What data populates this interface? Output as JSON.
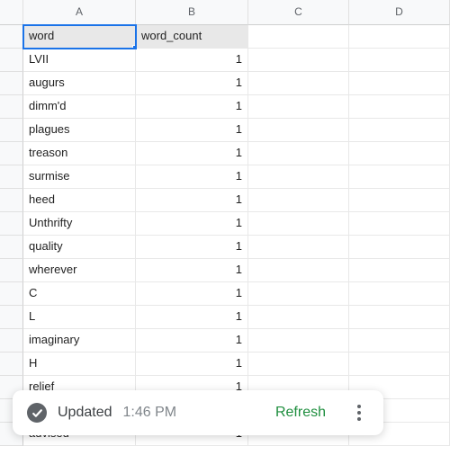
{
  "columns": [
    "A",
    "B",
    "C",
    "D"
  ],
  "header_row": {
    "col_a": "word",
    "col_b": "word_count"
  },
  "active_cell": "A1",
  "rows": [
    {
      "word": "LVII",
      "count": "1"
    },
    {
      "word": "augurs",
      "count": "1"
    },
    {
      "word": "dimm'd",
      "count": "1"
    },
    {
      "word": "plagues",
      "count": "1"
    },
    {
      "word": "treason",
      "count": "1"
    },
    {
      "word": "surmise",
      "count": "1"
    },
    {
      "word": "heed",
      "count": "1"
    },
    {
      "word": "Unthrifty",
      "count": "1"
    },
    {
      "word": "quality",
      "count": "1"
    },
    {
      "word": "wherever",
      "count": "1"
    },
    {
      "word": "C",
      "count": "1"
    },
    {
      "word": "L",
      "count": "1"
    },
    {
      "word": "imaginary",
      "count": "1"
    },
    {
      "word": "H",
      "count": "1"
    },
    {
      "word": "relief",
      "count": "1"
    },
    {
      "word": "",
      "count": ""
    },
    {
      "word": "advised",
      "count": "1"
    }
  ],
  "toast": {
    "status": "Updated",
    "time": "1:46 PM",
    "refresh_label": "Refresh"
  }
}
